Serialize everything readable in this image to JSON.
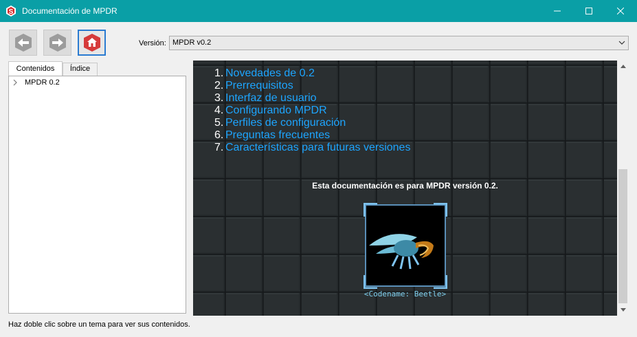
{
  "window": {
    "title": "Documentación de MPDR",
    "title_bar_color": "#0a9fa6"
  },
  "toolbar": {
    "back_icon": "arrow-left-icon",
    "forward_icon": "arrow-right-icon",
    "home_icon": "home-icon",
    "version_label": "Versión:",
    "version_value": "MPDR v0.2"
  },
  "tabs": [
    {
      "label": "Contenidos",
      "active": true
    },
    {
      "label": "Índice",
      "active": false
    }
  ],
  "tree": {
    "items": [
      {
        "label": "MPDR 0.2",
        "expanded": false
      }
    ]
  },
  "content": {
    "toc": [
      {
        "num": "1.",
        "label": "Novedades de 0.2"
      },
      {
        "num": "2.",
        "label": "Prerrequisitos"
      },
      {
        "num": "3.",
        "label": "Interfaz de usuario"
      },
      {
        "num": "4.",
        "label": "Configurando MPDR"
      },
      {
        "num": "5.",
        "label": "Perfiles de configuración"
      },
      {
        "num": "6.",
        "label": "Preguntas frecuentes"
      },
      {
        "num": "7.",
        "label": "Características para futuras versiones"
      }
    ],
    "note": "Esta documentación es para MPDR versión 0.2.",
    "codename": "<Codename: Beetle>",
    "link_color": "#1da5ff"
  },
  "status_bar": {
    "text": "Haz doble clic sobre un tema para ver sus contenidos."
  }
}
